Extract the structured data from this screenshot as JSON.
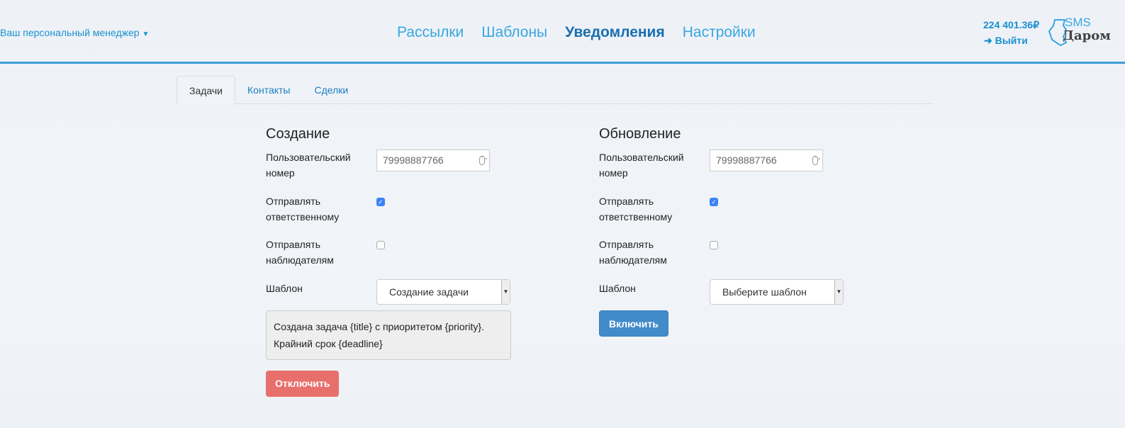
{
  "header": {
    "manager": "Ваш персональный менеджер",
    "nav": [
      "Рассылки",
      "Шаблоны",
      "Уведомления",
      "Настройки"
    ],
    "active_nav": 2,
    "balance": "224 401.36₽",
    "logout": "Выйти",
    "logo_top": "SMS",
    "logo_bottom": "Даром"
  },
  "tabs": [
    "Задачи",
    "Контакты",
    "Сделки"
  ],
  "create": {
    "title": "Создание",
    "user_number_label": "Пользовательский номер",
    "user_number": "79998887766",
    "send_responsible_label": "Отправлять ответственному",
    "send_responsible": true,
    "send_observers_label": "Отправлять наблюдателям",
    "send_observers": false,
    "template_label": "Шаблон",
    "template": "Создание задачи",
    "template_text": "Создана задача {title} с приоритетом {priority}. Крайний срок {deadline}",
    "button": "Отключить",
    "button_color": "#e8706c"
  },
  "update": {
    "title": "Обновление",
    "user_number_label": "Пользовательский номер",
    "user_number": "79998887766",
    "send_responsible_label": "Отправлять ответственному",
    "send_responsible": true,
    "send_observers_label": "Отправлять наблюдателям",
    "send_observers": false,
    "template_label": "Шаблон",
    "template": "Выберите шаблон",
    "button": "Включить",
    "button_color": "#428bca"
  }
}
